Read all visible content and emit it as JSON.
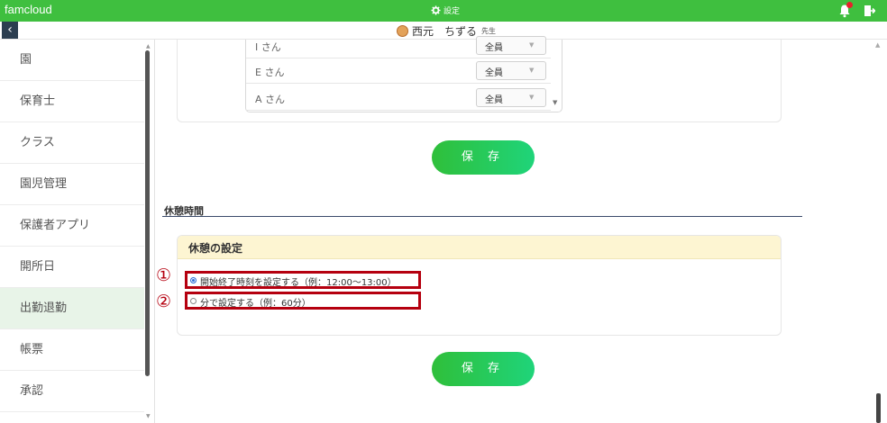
{
  "app": {
    "brand": "famcloud",
    "settings_label": "設定"
  },
  "user": {
    "name": "西元　ちずる",
    "suffix": "先生"
  },
  "sidebar": {
    "items": [
      {
        "label": "園"
      },
      {
        "label": "保育士"
      },
      {
        "label": "クラス"
      },
      {
        "label": "園児管理"
      },
      {
        "label": "保護者アプリ"
      },
      {
        "label": "開所日"
      },
      {
        "label": "出勤退勤"
      },
      {
        "label": "帳票"
      },
      {
        "label": "承認"
      }
    ],
    "active_index": 6
  },
  "staff_rows": [
    {
      "name": "I さん",
      "value": "全員"
    },
    {
      "name": "E さん",
      "value": "全員"
    },
    {
      "name": "A さん",
      "value": "全員"
    }
  ],
  "save_label": "保 存",
  "break_section": {
    "title": "休憩時間",
    "card_title": "休憩の設定",
    "options": [
      {
        "marker": "①",
        "label": "開始終了時刻を設定する（例：12:00〜13:00）",
        "selected": true
      },
      {
        "marker": "②",
        "label": "分で設定する（例：60分）",
        "selected": false
      }
    ]
  },
  "colors": {
    "topbar": "#3fbf3f",
    "highlight": "#b5000f",
    "save_gradient_start": "#2fbf3a",
    "save_gradient_end": "#1fd47a"
  }
}
